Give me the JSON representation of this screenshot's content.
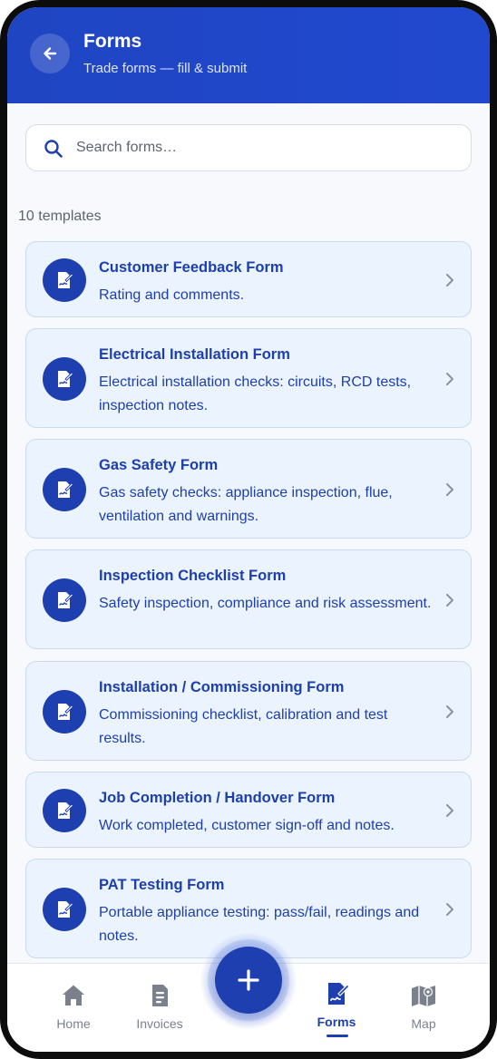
{
  "header": {
    "title": "Forms",
    "subtitle": "Trade forms — fill & submit"
  },
  "search": {
    "placeholder": "Search forms…",
    "value": ""
  },
  "count_label": "10 templates",
  "forms": [
    {
      "title": "Customer Feedback Form",
      "desc": "Rating and comments."
    },
    {
      "title": "Electrical Installation Form",
      "desc": "Electrical installation checks: circuits, RCD tests, inspection notes."
    },
    {
      "title": "Gas Safety Form",
      "desc": "Gas safety checks: appliance inspection, flue, ventilation and warnings."
    },
    {
      "title": "Inspection Checklist Form",
      "desc": "Safety inspection, compliance and risk assessment."
    },
    {
      "title": "Installation / Commissioning Form",
      "desc": "Commissioning checklist, calibration and test results."
    },
    {
      "title": "Job Completion / Handover Form",
      "desc": "Work completed, customer sign-off and notes."
    },
    {
      "title": "PAT Testing Form",
      "desc": "Portable appliance testing: pass/fail, readings and notes."
    }
  ],
  "nav": {
    "home": "Home",
    "invoices": "Invoices",
    "forms": "Forms",
    "map": "Map",
    "active": "forms"
  },
  "colors": {
    "accent": "#1e3fb0",
    "header": "#2149cf",
    "card_bg": "#ebf3fe",
    "card_border": "#c7dbf6"
  },
  "icons": {
    "back": "arrow-left-icon",
    "search": "search-icon",
    "form": "document-signature-icon",
    "chevron": "chevron-right-icon",
    "fab": "plus-icon"
  }
}
